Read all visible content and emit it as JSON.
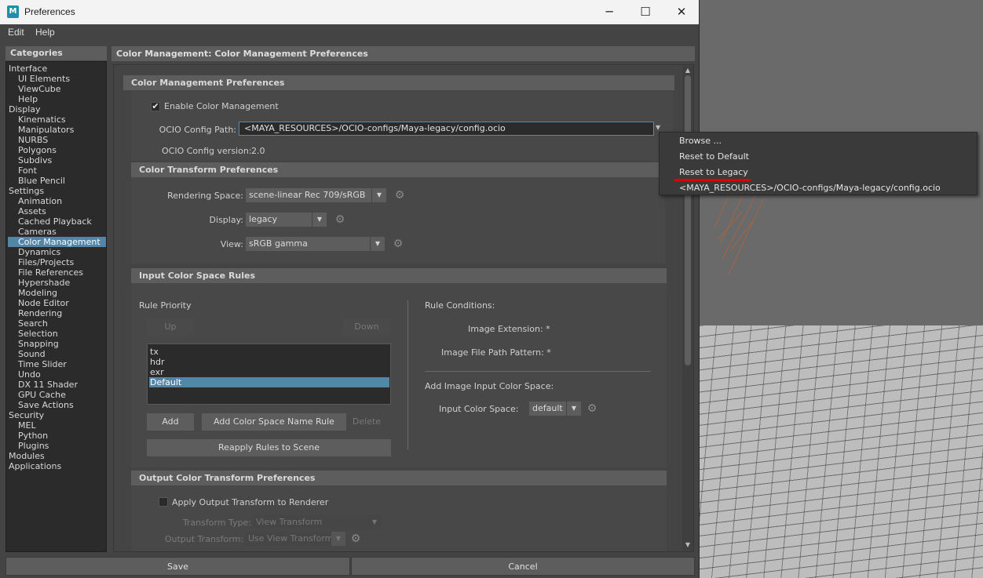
{
  "window": {
    "title": "Preferences",
    "app_icon_letter": "M",
    "minimize_glyph": "─",
    "maximize_glyph": "☐",
    "close_glyph": "✕"
  },
  "menu": [
    "Edit",
    "Help"
  ],
  "categories": {
    "header": "Categories",
    "items": [
      {
        "label": "Interface",
        "indent": 0
      },
      {
        "label": "UI Elements",
        "indent": 1
      },
      {
        "label": "ViewCube",
        "indent": 1
      },
      {
        "label": "Help",
        "indent": 1
      },
      {
        "label": "Display",
        "indent": 0
      },
      {
        "label": "Kinematics",
        "indent": 1
      },
      {
        "label": "Manipulators",
        "indent": 1
      },
      {
        "label": "NURBS",
        "indent": 1
      },
      {
        "label": "Polygons",
        "indent": 1
      },
      {
        "label": "Subdivs",
        "indent": 1
      },
      {
        "label": "Font",
        "indent": 1
      },
      {
        "label": "Blue Pencil",
        "indent": 1
      },
      {
        "label": "Settings",
        "indent": 0
      },
      {
        "label": "Animation",
        "indent": 1
      },
      {
        "label": "Assets",
        "indent": 1
      },
      {
        "label": "Cached Playback",
        "indent": 1
      },
      {
        "label": "Cameras",
        "indent": 1
      },
      {
        "label": "Color Management",
        "indent": 1,
        "selected": true
      },
      {
        "label": "Dynamics",
        "indent": 1
      },
      {
        "label": "Files/Projects",
        "indent": 1
      },
      {
        "label": "File References",
        "indent": 1
      },
      {
        "label": "Hypershade",
        "indent": 1
      },
      {
        "label": "Modeling",
        "indent": 1
      },
      {
        "label": "Node Editor",
        "indent": 1
      },
      {
        "label": "Rendering",
        "indent": 1
      },
      {
        "label": "Search",
        "indent": 1
      },
      {
        "label": "Selection",
        "indent": 1
      },
      {
        "label": "Snapping",
        "indent": 1
      },
      {
        "label": "Sound",
        "indent": 1
      },
      {
        "label": "Time Slider",
        "indent": 1
      },
      {
        "label": "Undo",
        "indent": 1
      },
      {
        "label": "DX 11 Shader",
        "indent": 1
      },
      {
        "label": "GPU Cache",
        "indent": 1
      },
      {
        "label": "Save Actions",
        "indent": 1
      },
      {
        "label": "Security",
        "indent": 0
      },
      {
        "label": "MEL",
        "indent": 1
      },
      {
        "label": "Python",
        "indent": 1
      },
      {
        "label": "Plugins",
        "indent": 1
      },
      {
        "label": "Modules",
        "indent": 0
      },
      {
        "label": "Applications",
        "indent": 0
      }
    ]
  },
  "main": {
    "header": "Color Management: Color Management Preferences",
    "cm_prefs": {
      "title": "Color Management Preferences",
      "enable_label": "Enable Color Management",
      "enable_checked": true,
      "check_glyph": "✔",
      "ocio_path_label": "OCIO Config Path:",
      "ocio_path_value": "<MAYA_RESOURCES>/OCIO-configs/Maya-legacy/config.ocio",
      "ocio_version_label": "OCIO Config version:",
      "ocio_version_value": "2.0"
    },
    "transform_prefs": {
      "title": "Color Transform Preferences",
      "rendering_space_label": "Rendering Space:",
      "rendering_space_value": "scene-linear Rec 709/sRGB",
      "display_label": "Display:",
      "display_value": "legacy",
      "view_label": "View:",
      "view_value": "sRGB gamma"
    },
    "input_rules": {
      "title": "Input Color Space Rules",
      "rule_priority_label": "Rule Priority",
      "up_label": "Up",
      "down_label": "Down",
      "rules": [
        "tx",
        "hdr",
        "exr",
        "Default"
      ],
      "selected_rule": "Default",
      "add_label": "Add",
      "add_name_rule_label": "Add Color Space Name Rule",
      "delete_label": "Delete",
      "reapply_label": "Reapply Rules to Scene",
      "rule_conditions_label": "Rule Conditions:",
      "image_extension_label": "Image Extension: *",
      "image_path_pattern_label": "Image File Path Pattern: *",
      "add_input_cs_label": "Add Image Input Color Space:",
      "input_cs_label": "Input Color Space:",
      "input_cs_value": "default"
    },
    "output_prefs": {
      "title": "Output Color Transform Preferences",
      "apply_label": "Apply Output Transform to Renderer",
      "apply_checked": false,
      "transform_type_label": "Transform Type:",
      "transform_type_value": "View Transform",
      "output_transform_label": "Output Transform:",
      "output_transform_value": "Use View Transform"
    }
  },
  "bottom": {
    "save_label": "Save",
    "cancel_label": "Cancel"
  },
  "popup": {
    "items": [
      "Browse ...",
      "Reset to Default",
      "Reset to Legacy",
      "<MAYA_RESOURCES>/OCIO-configs/Maya-legacy/config.ocio"
    ],
    "highlighted": "Reset to Legacy",
    "underline_color": "#e00000"
  },
  "colors": {
    "selection": "#5285a6",
    "panel_bg": "#444444",
    "header_bg": "#5d5d5d",
    "field_bg": "#2b2b2b"
  }
}
